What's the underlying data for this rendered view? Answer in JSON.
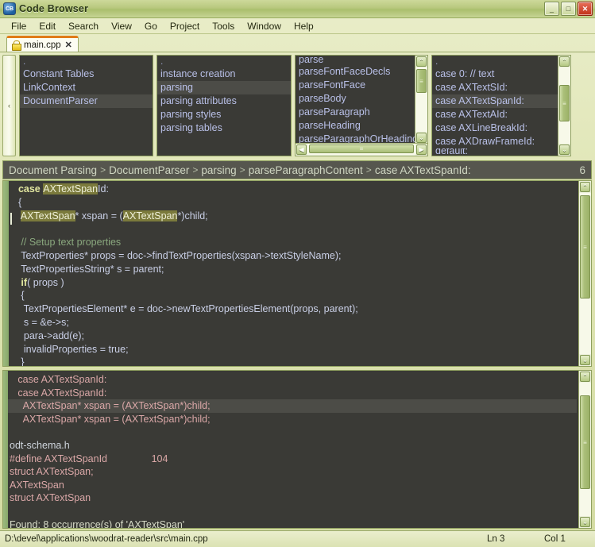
{
  "window": {
    "title": "Code Browser",
    "icon": "app-icon",
    "icon_text": "CB",
    "controls": {
      "minimize": "_",
      "maximize": "□",
      "close": "✕"
    }
  },
  "menu": {
    "items": [
      "File",
      "Edit",
      "Search",
      "View",
      "Go",
      "Project",
      "Tools",
      "Window",
      "Help"
    ]
  },
  "tabs": [
    {
      "label": "main.cpp",
      "icon": "lock-icon",
      "close": "✕"
    }
  ],
  "collapse_rail": {
    "glyph": "‹"
  },
  "panes": [
    {
      "name": "pane-classes",
      "rows": [
        {
          "text": ".",
          "selected": false,
          "dot": true
        },
        {
          "text": "Constant Tables",
          "selected": false
        },
        {
          "text": "LinkContext",
          "selected": false
        },
        {
          "text": "DocumentParser",
          "selected": true
        }
      ]
    },
    {
      "name": "pane-sections",
      "rows": [
        {
          "text": ".",
          "selected": false,
          "dot": true
        },
        {
          "text": "instance creation",
          "selected": false
        },
        {
          "text": "parsing",
          "selected": true
        },
        {
          "text": "parsing attributes",
          "selected": false
        },
        {
          "text": "parsing styles",
          "selected": false
        },
        {
          "text": "parsing tables",
          "selected": false
        }
      ]
    },
    {
      "name": "pane-methods",
      "rows": [
        {
          "text": "parse",
          "selected": false,
          "partial": true
        },
        {
          "text": "parseFontFaceDecls",
          "selected": false
        },
        {
          "text": "parseFontFace",
          "selected": false
        },
        {
          "text": "parseBody",
          "selected": false
        },
        {
          "text": "parseParagraph",
          "selected": false
        },
        {
          "text": "parseHeading",
          "selected": false
        },
        {
          "text": "parseParagraphOrHeading",
          "selected": false
        }
      ]
    },
    {
      "name": "pane-cases",
      "rows": [
        {
          "text": ".",
          "selected": false,
          "dot": true
        },
        {
          "text": "case 0: // text",
          "selected": false
        },
        {
          "text": "case AXTextSId:",
          "selected": false
        },
        {
          "text": "case AXTextSpanId:",
          "selected": true
        },
        {
          "text": "case AXTextAId:",
          "selected": false
        },
        {
          "text": "case AXLineBreakId:",
          "selected": false
        },
        {
          "text": "case AXDrawFrameId:",
          "selected": false
        },
        {
          "text": "default:",
          "selected": false,
          "partial": true
        }
      ]
    }
  ],
  "breadcrumb": {
    "parts": [
      "Document Parsing",
      "DocumentParser",
      "parsing",
      "parseParagraphContent",
      "case AXTextSpanId:"
    ],
    "separator": ">",
    "count": "6"
  },
  "editor": {
    "lines": [
      [
        {
          "t": "  ",
          "s": "pl"
        },
        {
          "t": "case ",
          "s": "kw"
        },
        {
          "t": "AXTextSpan",
          "s": "hl"
        },
        {
          "t": "Id:",
          "s": "pl"
        }
      ],
      [
        {
          "t": "  {",
          "s": "pl"
        }
      ],
      [
        {
          "t": "   ",
          "s": "pl"
        },
        {
          "t": "AXTextSpan",
          "s": "hl"
        },
        {
          "t": "* xspan = (",
          "s": "pl"
        },
        {
          "t": "AXTextSpan",
          "s": "hl"
        },
        {
          "t": "*)child;",
          "s": "pl"
        }
      ],
      [
        {
          "t": "",
          "s": "pl"
        }
      ],
      [
        {
          "t": "   ",
          "s": "pl"
        },
        {
          "t": "// Setup text properties",
          "s": "cm"
        }
      ],
      [
        {
          "t": "   TextProperties* props = doc->findTextProperties(xspan->textStyleName);",
          "s": "pl"
        }
      ],
      [
        {
          "t": "   TextPropertiesString* s = parent;",
          "s": "pl"
        }
      ],
      [
        {
          "t": "   ",
          "s": "pl"
        },
        {
          "t": "if",
          "s": "kw"
        },
        {
          "t": "( props )",
          "s": "pl"
        }
      ],
      [
        {
          "t": "   {",
          "s": "pl"
        }
      ],
      [
        {
          "t": "    TextPropertiesElement* e = doc->newTextPropertiesElement(props, parent);",
          "s": "pl"
        }
      ],
      [
        {
          "t": "    s = &e->s;",
          "s": "pl"
        }
      ],
      [
        {
          "t": "    para->add(e);",
          "s": "pl"
        }
      ],
      [
        {
          "t": "    invalidProperties = true;",
          "s": "pl"
        }
      ],
      [
        {
          "t": "   }",
          "s": "pl"
        }
      ]
    ]
  },
  "results": {
    "rows": [
      {
        "text": "   case AXTextSpanId:",
        "kind": "match",
        "selected": false
      },
      {
        "text": "   case AXTextSpanId:",
        "kind": "match",
        "selected": false
      },
      {
        "text": "     AXTextSpan* xspan = (AXTextSpan*)child;",
        "kind": "match",
        "selected": true
      },
      {
        "text": "     AXTextSpan* xspan = (AXTextSpan*)child;",
        "kind": "match",
        "selected": false
      },
      {
        "text": "",
        "kind": "blank",
        "selected": false
      },
      {
        "text": "odt-schema.h",
        "kind": "file",
        "selected": false
      },
      {
        "text": "#define AXTextSpanId                104",
        "kind": "match",
        "selected": false
      },
      {
        "text": "struct AXTextSpan;",
        "kind": "match",
        "selected": false
      },
      {
        "text": "AXTextSpan",
        "kind": "match",
        "selected": false
      },
      {
        "text": "struct AXTextSpan",
        "kind": "match",
        "selected": false
      },
      {
        "text": "",
        "kind": "blank",
        "selected": false
      },
      {
        "text": "Found: 8 occurrence(s) of 'AXTextSpan'",
        "kind": "found",
        "selected": false
      }
    ]
  },
  "statusbar": {
    "path": "D:\\devel\\applications\\woodrat-reader\\src\\main.cpp",
    "line": "Ln 3",
    "col": "Col 1"
  },
  "scrollbars": {
    "up_glyph": "⌃",
    "down_glyph": "⌄",
    "left_glyph": "◀",
    "right_glyph": "▶",
    "grip": "≡"
  },
  "colors": {
    "chrome": "#dfe5b4",
    "pane_bg": "#3a3a36",
    "accent_tab": "#e07b18",
    "highlight": "#7b7a3c",
    "match_text": "#dba8a8",
    "keyword": "#e3e8a0",
    "comment": "#8aa87e"
  }
}
